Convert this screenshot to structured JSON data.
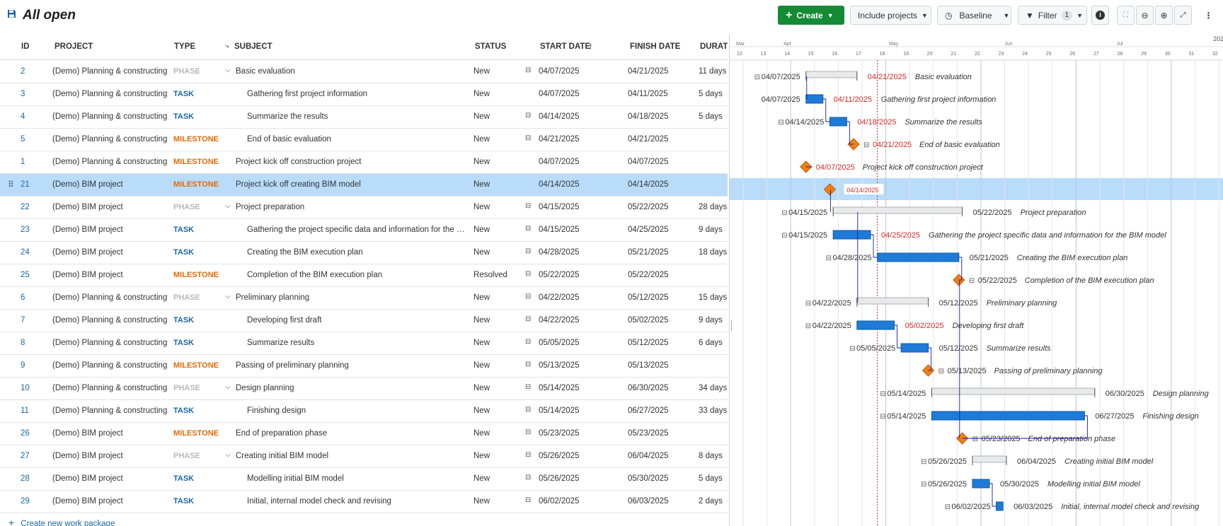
{
  "header": {
    "title": "All open",
    "create_label": "Create",
    "include_projects_label": "Include projects",
    "baseline_label": "Baseline",
    "filter_label": "Filter",
    "filter_count": "1"
  },
  "columns": {
    "id": "ID",
    "project": "PROJECT",
    "type": "TYPE",
    "subject": "SUBJECT",
    "status": "STATUS",
    "start_date": "START DATE",
    "finish_date": "FINISH DATE",
    "duration": "DURATI"
  },
  "rows": [
    {
      "id": "2",
      "project": "(Demo) Planning & constructing",
      "type": "PHASE",
      "subject": "Basic evaluation",
      "level": 0,
      "collapsible": true,
      "status": "New",
      "start": "04/07/2025",
      "start_icon": true,
      "finish": "04/21/2025",
      "duration": "11 days",
      "finish_red": true
    },
    {
      "id": "3",
      "project": "(Demo) Planning & constructing",
      "type": "TASK",
      "subject": "Gathering first project information",
      "level": 1,
      "collapsible": false,
      "status": "New",
      "start": "04/07/2025",
      "start_icon": false,
      "finish": "04/11/2025",
      "duration": "5 days",
      "finish_red": true
    },
    {
      "id": "4",
      "project": "(Demo) Planning & constructing",
      "type": "TASK",
      "subject": "Summarize the results",
      "level": 1,
      "collapsible": false,
      "status": "New",
      "start": "04/14/2025",
      "start_icon": true,
      "finish": "04/18/2025",
      "duration": "5 days",
      "finish_red": true
    },
    {
      "id": "5",
      "project": "(Demo) Planning & constructing",
      "type": "MILESTONE",
      "subject": "End of basic evaluation",
      "level": 1,
      "collapsible": false,
      "status": "New",
      "start": "04/21/2025",
      "start_icon": true,
      "finish": "04/21/2025",
      "duration": "",
      "finish_red": true
    },
    {
      "id": "1",
      "project": "(Demo) Planning & constructing",
      "type": "MILESTONE",
      "subject": "Project kick off construction project",
      "level": 0,
      "collapsible": false,
      "status": "New",
      "start": "04/07/2025",
      "start_icon": false,
      "finish": "04/07/2025",
      "duration": "",
      "finish_red": true
    },
    {
      "id": "21",
      "project": "(Demo) BIM project",
      "type": "MILESTONE",
      "subject": "Project kick off creating BIM model",
      "level": 0,
      "collapsible": false,
      "status": "New",
      "start": "04/14/2025",
      "start_icon": false,
      "finish": "04/14/2025",
      "duration": "",
      "selected": true,
      "finish_red": true
    },
    {
      "id": "22",
      "project": "(Demo) BIM project",
      "type": "PHASE",
      "subject": "Project preparation",
      "level": 0,
      "collapsible": true,
      "status": "New",
      "start": "04/15/2025",
      "start_icon": true,
      "finish": "05/22/2025",
      "duration": "28 days",
      "finish_red": false
    },
    {
      "id": "23",
      "project": "(Demo) BIM project",
      "type": "TASK",
      "subject": "Gathering the project specific data and information for the BI...",
      "gantt_subject": "Gathering the project specific data and information for the BIM model",
      "level": 1,
      "collapsible": false,
      "status": "New",
      "start": "04/15/2025",
      "start_icon": true,
      "finish": "04/25/2025",
      "duration": "9 days",
      "finish_red": true
    },
    {
      "id": "24",
      "project": "(Demo) BIM project",
      "type": "TASK",
      "subject": "Creating the BIM execution plan",
      "level": 1,
      "collapsible": false,
      "status": "New",
      "start": "04/28/2025",
      "start_icon": true,
      "finish": "05/21/2025",
      "duration": "18 days",
      "finish_red": false
    },
    {
      "id": "25",
      "project": "(Demo) BIM project",
      "type": "MILESTONE",
      "subject": "Completion of the BIM execution plan",
      "level": 1,
      "collapsible": false,
      "status": "Resolved",
      "start": "05/22/2025",
      "start_icon": true,
      "finish": "05/22/2025",
      "duration": "",
      "finish_red": false
    },
    {
      "id": "6",
      "project": "(Demo) Planning & constructing",
      "type": "PHASE",
      "subject": "Preliminary planning",
      "level": 0,
      "collapsible": true,
      "status": "New",
      "start": "04/22/2025",
      "start_icon": true,
      "finish": "05/12/2025",
      "duration": "15 days",
      "finish_red": false
    },
    {
      "id": "7",
      "project": "(Demo) Planning & constructing",
      "type": "TASK",
      "subject": "Developing first draft",
      "level": 1,
      "collapsible": false,
      "status": "New",
      "start": "04/22/2025",
      "start_icon": true,
      "finish": "05/02/2025",
      "duration": "9 days",
      "finish_red": true
    },
    {
      "id": "8",
      "project": "(Demo) Planning & constructing",
      "type": "TASK",
      "subject": "Summarize results",
      "level": 1,
      "collapsible": false,
      "status": "New",
      "start": "05/05/2025",
      "start_icon": true,
      "finish": "05/12/2025",
      "duration": "6 days",
      "finish_red": false
    },
    {
      "id": "9",
      "project": "(Demo) Planning & constructing",
      "type": "MILESTONE",
      "subject": "Passing of preliminary planning",
      "level": 0,
      "collapsible": false,
      "status": "New",
      "start": "05/13/2025",
      "start_icon": true,
      "finish": "05/13/2025",
      "duration": "",
      "finish_red": false
    },
    {
      "id": "10",
      "project": "(Demo) Planning & constructing",
      "type": "PHASE",
      "subject": "Design planning",
      "level": 0,
      "collapsible": true,
      "status": "New",
      "start": "05/14/2025",
      "start_icon": true,
      "finish": "06/30/2025",
      "duration": "34 days",
      "finish_red": false
    },
    {
      "id": "11",
      "project": "(Demo) Planning & constructing",
      "type": "TASK",
      "subject": "Finishing design",
      "level": 1,
      "collapsible": false,
      "status": "New",
      "start": "05/14/2025",
      "start_icon": true,
      "finish": "06/27/2025",
      "duration": "33 days",
      "finish_red": false
    },
    {
      "id": "26",
      "project": "(Demo) BIM project",
      "type": "MILESTONE",
      "subject": "End of preparation phase",
      "level": 0,
      "collapsible": false,
      "status": "New",
      "start": "05/23/2025",
      "start_icon": true,
      "finish": "05/23/2025",
      "duration": "",
      "finish_red": false
    },
    {
      "id": "27",
      "project": "(Demo) BIM project",
      "type": "PHASE",
      "subject": "Creating initial BIM model",
      "level": 0,
      "collapsible": true,
      "status": "New",
      "start": "05/26/2025",
      "start_icon": true,
      "finish": "06/04/2025",
      "duration": "8 days",
      "finish_red": false
    },
    {
      "id": "28",
      "project": "(Demo) BIM project",
      "type": "TASK",
      "subject": "Modelling initial BIM model",
      "level": 1,
      "collapsible": false,
      "status": "New",
      "start": "05/26/2025",
      "start_icon": true,
      "finish": "05/30/2025",
      "duration": "5 days",
      "finish_red": false
    },
    {
      "id": "29",
      "project": "(Demo) BIM project",
      "type": "TASK",
      "subject": "Initial, internal model check and revising",
      "level": 1,
      "collapsible": false,
      "status": "New",
      "start": "06/02/2025",
      "start_icon": true,
      "finish": "06/03/2025",
      "duration": "2 days",
      "finish_red": false
    }
  ],
  "create_new_label": "Create new work package",
  "gantt": {
    "year_label": "202",
    "months": [
      {
        "label": "Mar",
        "date": "03/17/2025"
      },
      {
        "label": "Apr",
        "date": "03/31/2025"
      },
      {
        "label": "May",
        "date": "05/01/2025"
      },
      {
        "label": "Jun",
        "date": "06/04/2025"
      },
      {
        "label": "Jul",
        "date": "07/07/2025"
      }
    ],
    "weeks": [
      "12",
      "13",
      "14",
      "15",
      "16",
      "17",
      "18",
      "19",
      "20",
      "21",
      "22",
      "23",
      "24",
      "25",
      "26",
      "27",
      "28",
      "29",
      "30",
      "31",
      "32"
    ],
    "first_week_start": "03/17/2025",
    "today": "04/28/2025",
    "hover_label": "04/14/2025",
    "colors": {
      "task": "#1e7bd8",
      "phase": "#e9e9e9",
      "milestone": "#f07f16",
      "selected_row": "#b9dcfa",
      "overdue": "#d62a2a"
    }
  }
}
